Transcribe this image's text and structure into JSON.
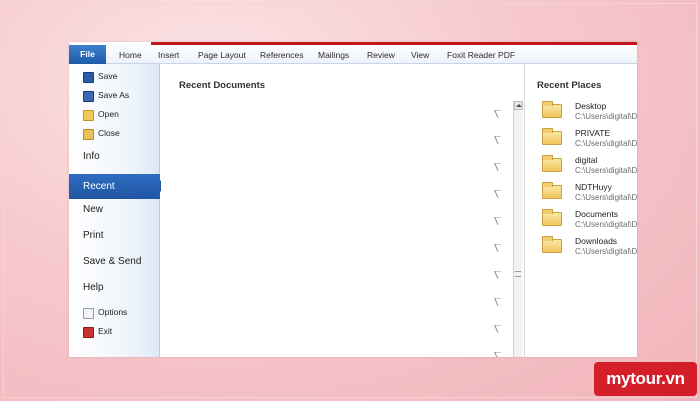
{
  "ribbon": {
    "tabs": [
      "File",
      "Home",
      "Insert",
      "Page Layout",
      "References",
      "Mailings",
      "Review",
      "View",
      "Foxit Reader PDF"
    ]
  },
  "nav": {
    "save": "Save",
    "save_as": "Save As",
    "open": "Open",
    "close": "Close",
    "info": "Info",
    "recent": "Recent",
    "new": "New",
    "print": "Print",
    "save_send": "Save & Send",
    "help": "Help",
    "options": "Options",
    "exit": "Exit"
  },
  "recent_documents": {
    "title": "Recent Documents"
  },
  "recent_places": {
    "title": "Recent Places",
    "items": [
      {
        "name": "Desktop",
        "path": "C:\\Users\\digital\\D"
      },
      {
        "name": "PRIVATE",
        "path": "C:\\Users\\digital\\D"
      },
      {
        "name": "digital",
        "path": "C:\\Users\\digital\\D"
      },
      {
        "name": "NDTHuyy",
        "path": "C:\\Users\\digital\\D"
      },
      {
        "name": "Documents",
        "path": "C:\\Users\\digital\\D"
      },
      {
        "name": "Downloads",
        "path": "C:\\Users\\digital\\D"
      }
    ]
  },
  "watermark": "mytour.vn"
}
